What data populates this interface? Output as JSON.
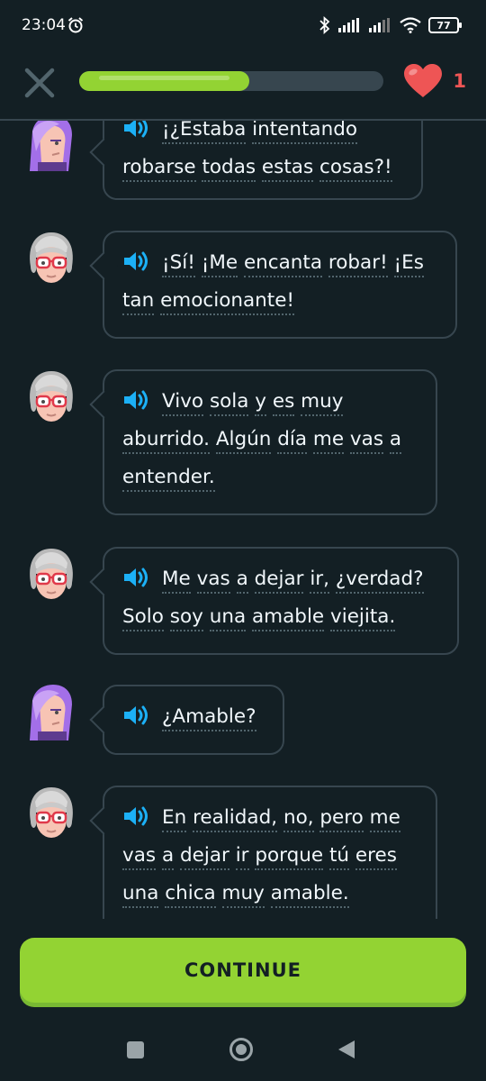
{
  "status_bar": {
    "time": "23:04",
    "battery": "77"
  },
  "header": {
    "progress": 0.56,
    "hearts": "1",
    "accent_color": "#93d333",
    "heart_color": "#ee5555"
  },
  "messages": [
    {
      "speaker": "girl",
      "lines": [
        [
          "¡¿Estaba",
          "intentando"
        ],
        [
          "robarse",
          "todas",
          "estas",
          "cosas?!"
        ]
      ]
    },
    {
      "speaker": "grandma",
      "lines": [
        [
          "¡Sí!",
          "¡Me",
          "encanta",
          "robar!",
          "¡Es"
        ],
        [
          "tan",
          "emocionante!"
        ]
      ]
    },
    {
      "speaker": "grandma",
      "lines": [
        [
          "Vivo",
          "sola",
          "y",
          "es",
          "muy"
        ],
        [
          "aburrido.",
          "Algún",
          "día",
          "me",
          "vas",
          "a"
        ],
        [
          "entender."
        ]
      ]
    },
    {
      "speaker": "grandma",
      "lines": [
        [
          "Me",
          "vas",
          "a",
          "dejar",
          "ir,",
          "¿verdad?"
        ],
        [
          "Solo",
          "soy",
          "una",
          "amable",
          "viejita."
        ]
      ]
    },
    {
      "speaker": "girl",
      "lines": [
        [
          "¿Amable?"
        ]
      ]
    },
    {
      "speaker": "grandma",
      "lines": [
        [
          "En",
          "realidad,",
          "no,",
          "pero",
          "me"
        ],
        [
          "vas",
          "a",
          "dejar",
          "ir",
          "porque",
          "tú",
          "eres"
        ],
        [
          "una",
          "chica",
          "muy",
          "amable."
        ]
      ]
    }
  ],
  "continue_label": "CONTINUE"
}
